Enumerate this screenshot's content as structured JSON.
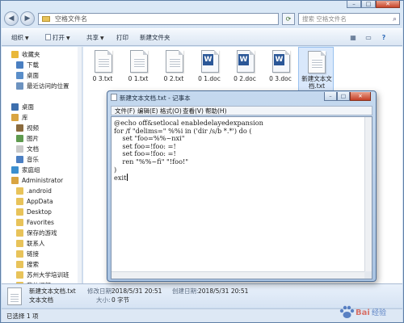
{
  "explorer": {
    "address_path": "空格文件名",
    "search_placeholder": "搜索 空格文件名",
    "toolbar": {
      "organize": "组织",
      "open": "打开",
      "share": "共享",
      "print": "打印",
      "new_folder": "新建文件夹"
    },
    "nav": [
      {
        "label": "收藏夹",
        "icon": "star-icon",
        "color": "#e9b83a"
      },
      {
        "label": "下载",
        "icon": "download-folder-icon",
        "color": "#4a7fc1"
      },
      {
        "label": "桌面",
        "icon": "desktop-icon",
        "color": "#5a8ec9"
      },
      {
        "label": "最近访问的位置",
        "icon": "recent-places-icon",
        "color": "#6d93c0"
      },
      {
        "label": "桌面",
        "icon": "desktop-icon",
        "color": "#3d6fae"
      },
      {
        "label": "库",
        "icon": "library-icon",
        "color": "#d9a441"
      },
      {
        "label": "视频",
        "icon": "video-library-icon",
        "color": "#8b6b3e"
      },
      {
        "label": "图片",
        "icon": "picture-library-icon",
        "color": "#5f9b4f"
      },
      {
        "label": "文档",
        "icon": "document-library-icon",
        "color": "#c9c9c9"
      },
      {
        "label": "音乐",
        "icon": "music-library-icon",
        "color": "#4b7fc3"
      },
      {
        "label": "家庭组",
        "icon": "homegroup-icon",
        "color": "#3c8fcf"
      },
      {
        "label": "Administrator",
        "icon": "user-folder-icon",
        "color": "#d9a441"
      },
      {
        "label": ".android",
        "icon": "folder-icon",
        "color": "#e8c35a"
      },
      {
        "label": "AppData",
        "icon": "folder-icon",
        "color": "#e8c35a"
      },
      {
        "label": "Desktop",
        "icon": "folder-icon",
        "color": "#e8c35a"
      },
      {
        "label": "Favorites",
        "icon": "folder-icon",
        "color": "#e8c35a"
      },
      {
        "label": "保存的游戏",
        "icon": "folder-icon",
        "color": "#e8c35a"
      },
      {
        "label": "联系人",
        "icon": "folder-icon",
        "color": "#e8c35a"
      },
      {
        "label": "链接",
        "icon": "folder-icon",
        "color": "#e8c35a"
      },
      {
        "label": "搜索",
        "icon": "folder-icon",
        "color": "#e8c35a"
      },
      {
        "label": "苏州大学培训班",
        "icon": "folder-icon",
        "color": "#e8c35a"
      },
      {
        "label": "我的视频",
        "icon": "folder-icon",
        "color": "#e8c35a"
      }
    ],
    "files": [
      {
        "name": "0 3.txt",
        "kind": "txt"
      },
      {
        "name": "0 1.txt",
        "kind": "txt"
      },
      {
        "name": "0 2.txt",
        "kind": "txt"
      },
      {
        "name": "0 1.doc",
        "kind": "doc"
      },
      {
        "name": "0 2.doc",
        "kind": "doc"
      },
      {
        "name": "0 3.doc",
        "kind": "doc"
      },
      {
        "name": "新建文本文档.txt",
        "kind": "txt"
      }
    ],
    "details": {
      "file_name": "新建文本文档.txt",
      "file_type": "文本文档",
      "modified_label": "修改日期:",
      "modified_value": "2018/5/31 20:51",
      "created_label": "创建日期:",
      "created_value": "2018/5/31 20:51",
      "size_label": "大小:",
      "size_value": "0 字节"
    },
    "status": "已选择 1 项"
  },
  "notepad": {
    "title": "新建文本文档.txt - 记事本",
    "menu": [
      "文件(F)",
      "编辑(E)",
      "格式(O)",
      "查看(V)",
      "帮助(H)"
    ],
    "content": "@echo off&setlocal enabledelayedexpansion\nfor /f \"delims=\" %%i in ('dir /s/b *.*') do (\n    set \"foo=%%~nxi\"\n    set foo=!foo: =!\n    set foo=!foo: =!\n    ren \"%%~fi\" \"!foo!\"\n)\nexit"
  },
  "watermark": "Baidu 经验"
}
